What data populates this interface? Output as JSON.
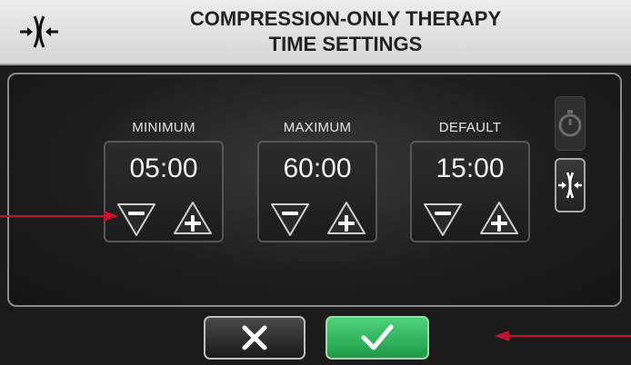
{
  "header": {
    "title_line1": "COMPRESSION-ONLY THERAPY",
    "title_line2": "TIME SETTINGS",
    "icon": "compression-icon"
  },
  "settings": [
    {
      "label": "MINIMUM",
      "value": "05:00"
    },
    {
      "label": "MAXIMUM",
      "value": "60:00"
    },
    {
      "label": "DEFAULT",
      "value": "15:00"
    }
  ],
  "side_buttons": [
    {
      "icon": "timer-icon",
      "state": "disabled"
    },
    {
      "icon": "compression-icon",
      "state": "enabled"
    }
  ],
  "footer": {
    "cancel_icon": "close-icon",
    "confirm_icon": "checkmark-icon"
  },
  "colors": {
    "accent_green": "#2fb85c",
    "annotation_arrow": "#c8102e"
  }
}
